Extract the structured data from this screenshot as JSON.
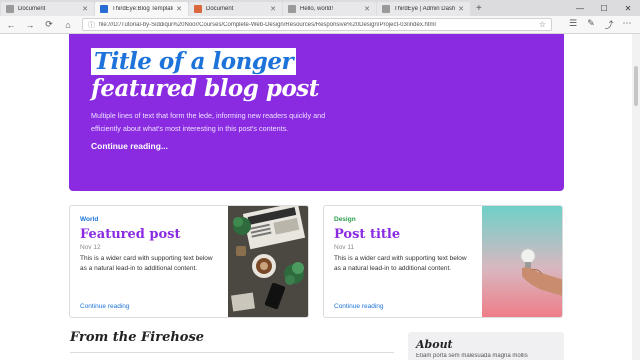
{
  "browser": {
    "tabs": [
      {
        "label": "Document",
        "favicon": "grey",
        "active": false
      },
      {
        "label": "ThirdEye:Blog Template",
        "favicon": "blue",
        "active": true
      },
      {
        "label": "Document",
        "favicon": "pp",
        "active": false
      },
      {
        "label": "Hello, world!",
        "favicon": "grey",
        "active": false
      },
      {
        "label": "ThirdEye | Admin Dashboar",
        "favicon": "grey",
        "active": false
      }
    ],
    "new_tab": "+",
    "window_controls": {
      "minimize": "—",
      "maximize": "☐",
      "close": "✕"
    },
    "nav": {
      "back": "←",
      "forward": "→",
      "reload": "⟳",
      "home": "⌂"
    },
    "address": {
      "scheme": "ⓘ",
      "url": "file:///D:/Tutorial-by-Siddiqui%20Noor/Courses/Complete-Web-Design/Resources/Responsive%20Design/Project-03/index.html"
    },
    "right_icons": [
      "☰",
      "✎",
      "⤴",
      "⋯"
    ]
  },
  "hero": {
    "title_highlight": "Title of a longer",
    "title_rest": "featured blog post",
    "lede": "Multiple lines of text that form the lede, informing new readers quickly and efficiently about what's most interesting in this post's contents.",
    "link": "Continue reading..."
  },
  "cards": [
    {
      "category": "World",
      "category_color": "#1d73d9",
      "title": "Featured post",
      "date": "Nov 12",
      "text": "This is a wider card with supporting text below as a natural lead-in to additional content.",
      "link": "Continue reading"
    },
    {
      "category": "Design",
      "category_color": "#2a9d4b",
      "title": "Post title",
      "date": "Nov 11",
      "text": "This is a wider card with supporting text below as a natural lead-in to additional content.",
      "link": "Continue reading"
    }
  ],
  "sections": {
    "firehose": "From the Firehose",
    "about_title": "About",
    "about_text": "Etiam porta sem malesuada magna mollis"
  },
  "colors": {
    "accent": "#8a2be2",
    "link": "#1d73d9"
  }
}
